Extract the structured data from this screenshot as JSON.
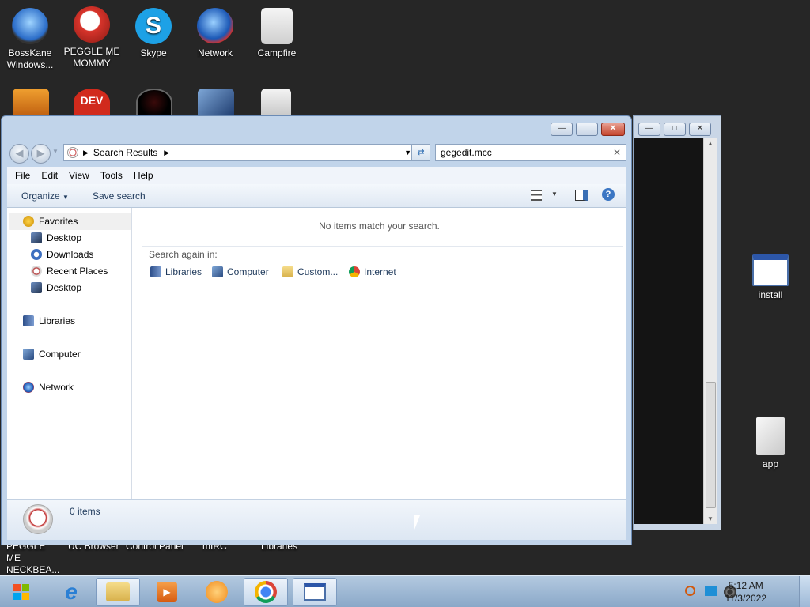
{
  "desktop": {
    "icons_top": [
      {
        "name": "bosskane-icon",
        "label": "BossKane Windows...",
        "color": "#5aa6e6"
      },
      {
        "name": "peggle-icon",
        "label": "PEGGLE ME MOMMY",
        "color": "#d8342b"
      },
      {
        "name": "skype-icon",
        "label": "Skype",
        "color": "#1da1e6"
      },
      {
        "name": "network-icon",
        "label": "Network",
        "color": "#1b58b6"
      },
      {
        "name": "campfire-icon",
        "label": "Campfire",
        "color": "#e6e6e6"
      }
    ],
    "bottom_labels": [
      "PEGGLE ME NECKBEA...",
      "UC Browser",
      "Control Panel",
      "mIRC",
      "Libraries"
    ],
    "right_icons": [
      {
        "label": "install"
      },
      {
        "label": "app"
      }
    ]
  },
  "explorer": {
    "address": {
      "path": "Search Results"
    },
    "search": {
      "value": "gegedit.mcc"
    },
    "menu": [
      "File",
      "Edit",
      "View",
      "Tools",
      "Help"
    ],
    "toolbar": {
      "organize": "Organize",
      "save_search": "Save search"
    },
    "nav": {
      "favorites": "Favorites",
      "fav_items": [
        "Desktop",
        "Downloads",
        "Recent Places",
        "Desktop"
      ],
      "libraries": "Libraries",
      "computer": "Computer",
      "network": "Network"
    },
    "main": {
      "empty_message": "No items match your search.",
      "search_again": "Search again in:",
      "locations": [
        "Libraries",
        "Computer",
        "Custom...",
        "Internet"
      ]
    },
    "status": {
      "count": "0 items"
    }
  },
  "taskbar": {
    "time": "5:12 AM",
    "date": "11/3/2022"
  },
  "colors": {
    "desktop": "#262626",
    "window_frame": "#c1d4ea",
    "taskbar": "#9fb9d6",
    "link_text": "#1e395b"
  }
}
